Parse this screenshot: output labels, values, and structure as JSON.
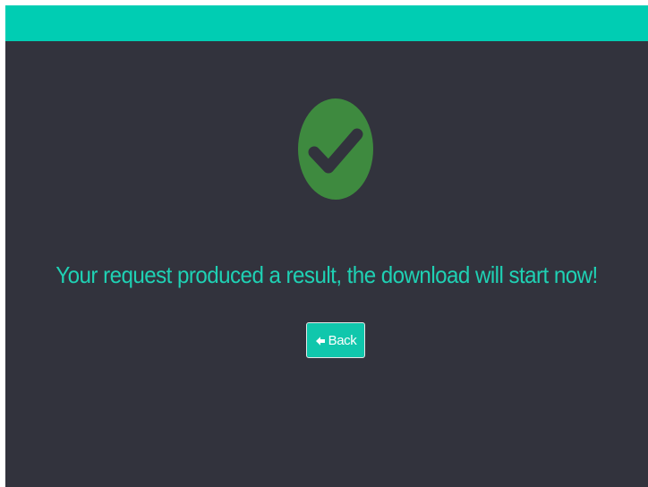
{
  "page": {
    "message": "Your request produced a result, the download will start now!",
    "back_label": "Back"
  },
  "icons": {
    "status": "check-icon",
    "back": "arrow-left-icon"
  },
  "colors": {
    "accent": "#00cdb3",
    "background": "#32333d",
    "success": "#3e8a3f",
    "message_text": "#1fd1b4",
    "button": "#10c7ac"
  }
}
